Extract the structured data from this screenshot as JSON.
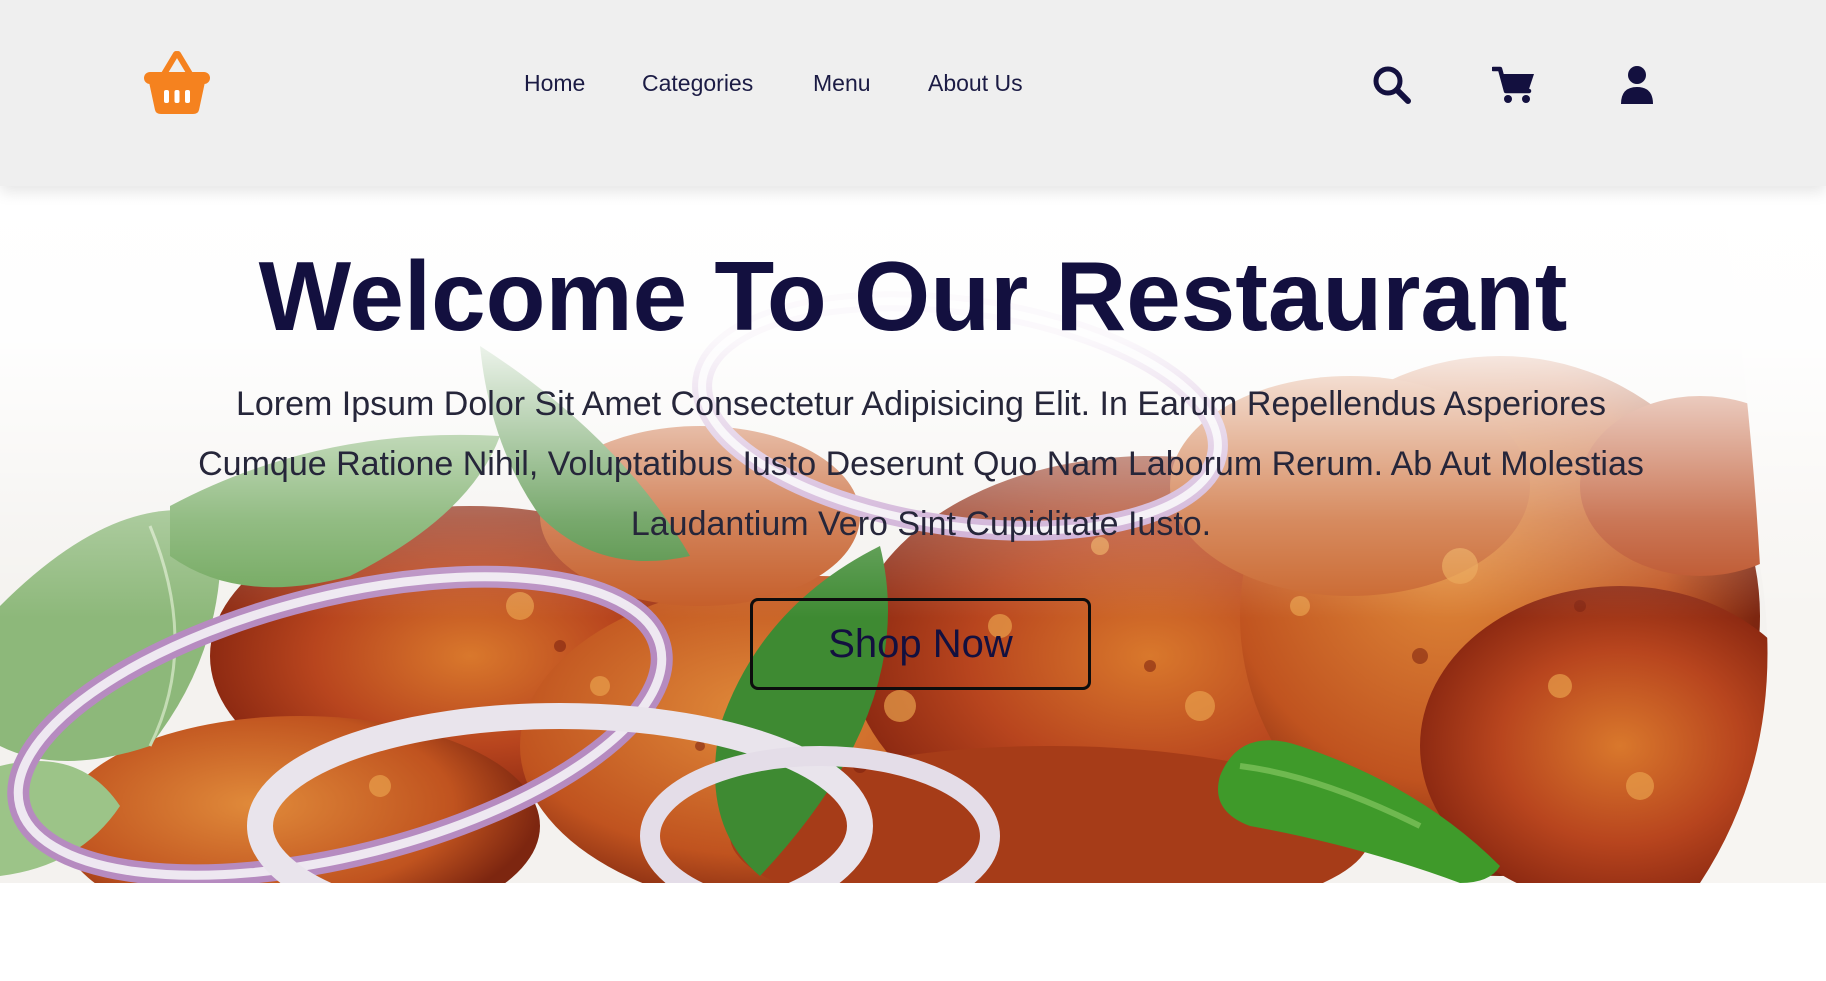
{
  "header": {
    "logo_icon": "shopping-basket-icon",
    "logo_color": "#f5821f",
    "nav": [
      {
        "label": "Home"
      },
      {
        "label": "Categories"
      },
      {
        "label": "Menu"
      },
      {
        "label": "About Us"
      }
    ],
    "icons": [
      "search-icon",
      "shopping-cart-icon",
      "user-icon"
    ],
    "icon_color": "#13103f"
  },
  "hero": {
    "title": "Welcome To Our Restaurant",
    "description": "Lorem Ipsum Dolor Sit Amet Consectetur Adipisicing Elit. In Earum Repellendus Asperiores Cumque Ratione Nihil, Voluptatibus Iusto Deserunt Quo Nam Laborum Rerum. Ab Aut Molestias Laudantium Vero Sint Cupiditate Iusto.",
    "button_label": "Shop Now",
    "background_image": "spicy fried chicken with onion rings, curry leaves and green chili"
  },
  "colors": {
    "header_bg": "#efefef",
    "title": "#13103f",
    "text": "#26263a",
    "accent": "#f5821f"
  }
}
